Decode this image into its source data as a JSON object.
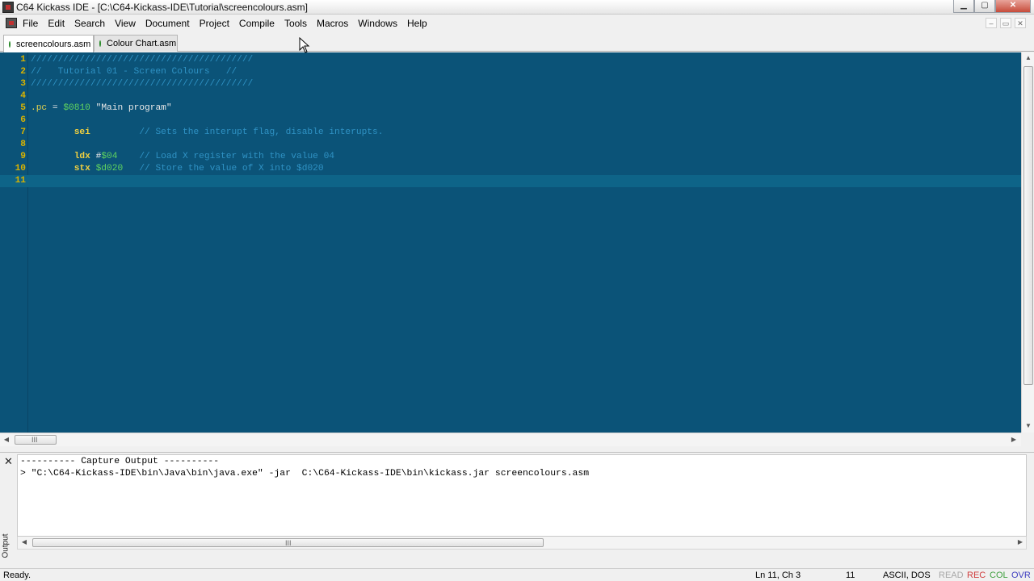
{
  "window": {
    "title": "C64 Kickass IDE - [C:\\C64-Kickass-IDE\\Tutorial\\screencolours.asm]",
    "controls": {
      "minimize": "▁",
      "maximize": "▢",
      "close": "✕"
    }
  },
  "menubar": {
    "items": [
      "File",
      "Edit",
      "Search",
      "View",
      "Document",
      "Project",
      "Compile",
      "Tools",
      "Macros",
      "Windows",
      "Help"
    ],
    "mdi_controls": [
      "–",
      "▭",
      "✕"
    ]
  },
  "tabs": [
    {
      "label": "screencolours.asm",
      "active": true
    },
    {
      "label": "Colour Chart.asm",
      "active": false
    }
  ],
  "editor": {
    "current_line": 11,
    "lines": [
      {
        "n": "1",
        "tokens": [
          {
            "t": "comment",
            "v": "/////////////////////////////////////////"
          }
        ]
      },
      {
        "n": "2",
        "tokens": [
          {
            "t": "comment",
            "v": "//   Tutorial 01 - Screen Colours   //"
          }
        ]
      },
      {
        "n": "3",
        "tokens": [
          {
            "t": "comment",
            "v": "/////////////////////////////////////////"
          }
        ]
      },
      {
        "n": "4",
        "tokens": []
      },
      {
        "n": "5",
        "tokens": [
          {
            "t": "directive",
            "v": ".pc"
          },
          {
            "t": "op",
            "v": " = "
          },
          {
            "t": "num",
            "v": "$0810"
          },
          {
            "t": "str",
            "v": " \"Main program\""
          }
        ]
      },
      {
        "n": "6",
        "tokens": []
      },
      {
        "n": "7",
        "tokens": [
          {
            "t": "op",
            "v": "        "
          },
          {
            "t": "kw",
            "v": "sei"
          },
          {
            "t": "op",
            "v": "         "
          },
          {
            "t": "comment",
            "v": "// Sets the interupt flag, disable interupts."
          }
        ]
      },
      {
        "n": "8",
        "tokens": []
      },
      {
        "n": "9",
        "tokens": [
          {
            "t": "op",
            "v": "        "
          },
          {
            "t": "kw",
            "v": "ldx"
          },
          {
            "t": "hash",
            "v": " #"
          },
          {
            "t": "num",
            "v": "$04"
          },
          {
            "t": "op",
            "v": "    "
          },
          {
            "t": "comment",
            "v": "// Load X register with the value 04"
          }
        ]
      },
      {
        "n": "10",
        "tokens": [
          {
            "t": "op",
            "v": "        "
          },
          {
            "t": "kw",
            "v": "stx"
          },
          {
            "t": "op",
            "v": " "
          },
          {
            "t": "num",
            "v": "$d020"
          },
          {
            "t": "op",
            "v": "   "
          },
          {
            "t": "comment",
            "v": "// Store the value of X into $d020"
          }
        ]
      },
      {
        "n": "11",
        "tokens": []
      }
    ]
  },
  "scrollbar": {
    "grip": "III",
    "up": "▲",
    "down": "▼",
    "left": "◀",
    "right": "▶"
  },
  "output": {
    "panel_label": "Output",
    "close": "✕",
    "lines": [
      "---------- Capture Output ----------",
      "> \"C:\\C64-Kickass-IDE\\bin\\Java\\bin\\java.exe\" -jar  C:\\C64-Kickass-IDE\\bin\\kickass.jar screencolours.asm"
    ]
  },
  "statusbar": {
    "message": "Ready.",
    "position": "Ln 11, Ch 3",
    "line_count": "11",
    "encoding": "ASCII, DOS",
    "read": "READ",
    "rec": "REC",
    "col": "COL",
    "ovr": "OVR"
  },
  "colors": {
    "editor_bg": "#0b5378",
    "current_line_bg": "#0e6488",
    "line_numbers": "#d9b300",
    "comment": "#2f92c4",
    "keyword": "#f0d040",
    "number": "#5fd35f",
    "status_rec": "#d04040",
    "status_col": "#40a040",
    "status_ovr": "#4040c0"
  }
}
